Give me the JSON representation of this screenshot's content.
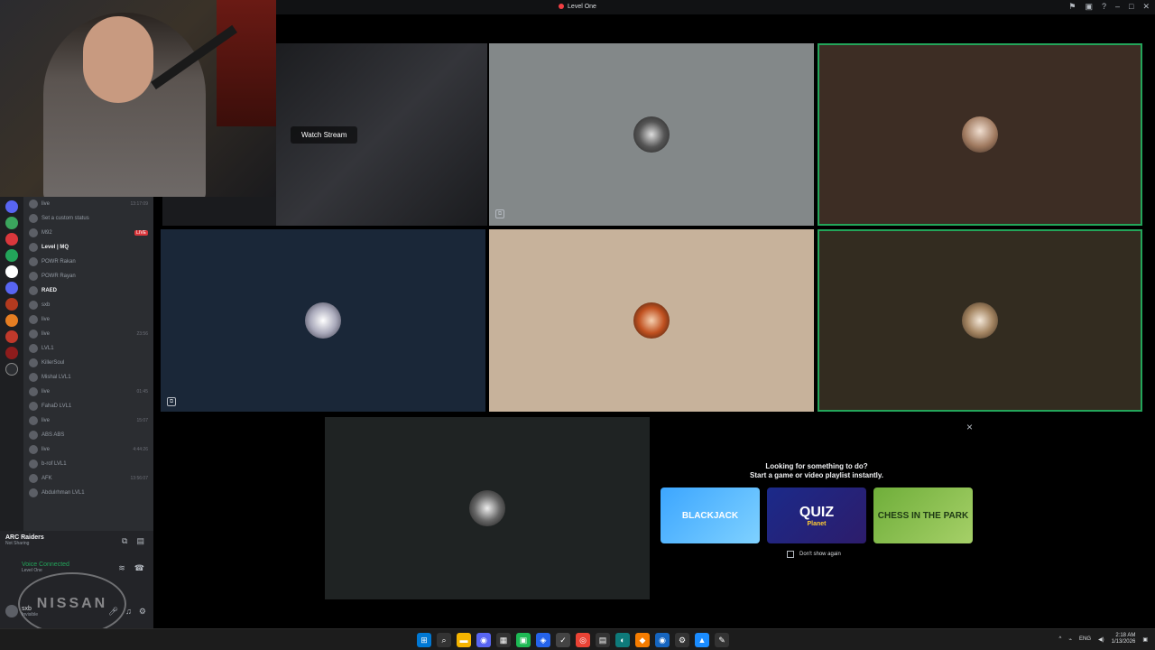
{
  "window": {
    "title": "Level One"
  },
  "stream": {
    "watch_label": "Watch Stream"
  },
  "voice_rows": [
    {
      "name": "live",
      "time": "13:17:09",
      "bold": false
    },
    {
      "name": "Set a custom status",
      "time": "",
      "bold": false
    },
    {
      "name": "M92",
      "live": "LIVE",
      "bold": false
    },
    {
      "name": "Level | MQ",
      "time": "",
      "bold": true
    },
    {
      "name": "POWR Rakan",
      "time": "",
      "bold": false
    },
    {
      "name": "POWR Rayan",
      "time": "",
      "bold": false
    },
    {
      "name": "RAED",
      "time": "",
      "bold": true
    },
    {
      "name": "sxb",
      "time": "",
      "bold": false
    },
    {
      "name": "live",
      "time": "",
      "bold": false
    },
    {
      "name": "live",
      "time": "23:56",
      "bold": false
    },
    {
      "name": "LVL1",
      "time": "",
      "bold": false
    },
    {
      "name": "KillerSoul",
      "time": "",
      "bold": false
    },
    {
      "name": "Mishal LVL1",
      "time": "",
      "bold": false
    },
    {
      "name": "live",
      "time": "01:45",
      "bold": false
    },
    {
      "name": "FahaD LVL1",
      "time": "",
      "bold": false
    },
    {
      "name": "live",
      "time": "15:07",
      "bold": false
    },
    {
      "name": "ABS ABS",
      "time": "",
      "bold": false
    },
    {
      "name": "live",
      "time": "4:44:26",
      "bold": false
    },
    {
      "name": "b-rof LVL1",
      "time": "",
      "bold": false
    },
    {
      "name": "AFK",
      "time": "13:56:07",
      "bold": false
    },
    {
      "name": "Abdulrhman LVL1",
      "time": "",
      "bold": false
    }
  ],
  "activity_status": {
    "name": "ARC Raiders",
    "sub": "Not Sharing"
  },
  "voice_connected": {
    "label": "Voice Connected",
    "channel": "Level One"
  },
  "user": {
    "name": "sxb",
    "status": "Invisible"
  },
  "nissan_watermark": "NISSAN",
  "activity_panel": {
    "heading_line1": "Looking for something to do?",
    "heading_line2": "Start a game or video playlist instantly.",
    "cards": [
      "BLACKJACK",
      "QUIZ",
      "Planet",
      "CHESS IN THE PARK"
    ],
    "dont_show": "Don't show again",
    "close": "×"
  },
  "tray": {
    "lang": "ENG",
    "time": "2:18 AM",
    "date": "1/13/2026"
  },
  "icons": [
    "close-icon",
    "pin-icon",
    "inbox-icon",
    "help-icon",
    "mic-icon",
    "headphones-icon",
    "settings-icon",
    "disconnect-icon",
    "screen-share-icon",
    "windows-start-icon",
    "search-icon"
  ]
}
